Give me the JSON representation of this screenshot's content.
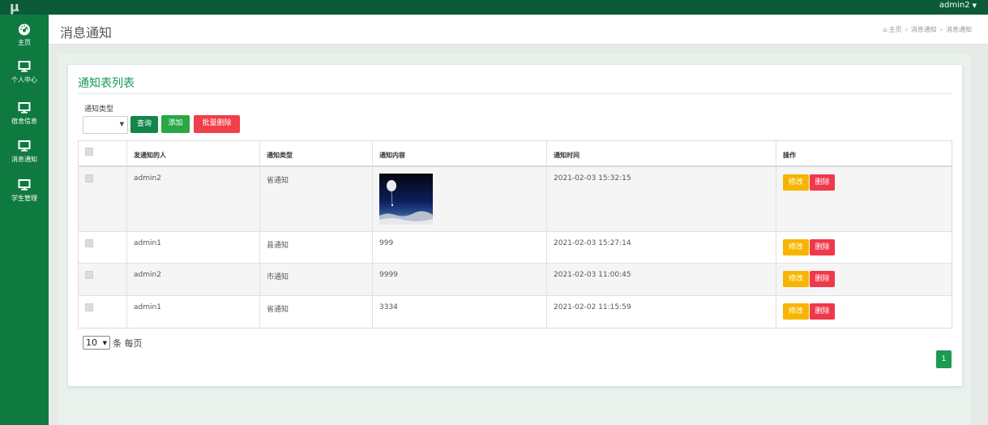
{
  "app": {
    "logo_text": "μ",
    "user": "admin2"
  },
  "sidebar": {
    "items": [
      {
        "label": "主页",
        "icon": "dashboard-icon"
      },
      {
        "label": "个人中心",
        "icon": "monitor-icon"
      },
      {
        "label": "宿舍信息",
        "icon": "monitor-icon"
      },
      {
        "label": "消息通知",
        "icon": "monitor-icon"
      },
      {
        "label": "学生管理",
        "icon": "monitor-icon"
      }
    ]
  },
  "header": {
    "title": "消息通知",
    "breadcrumb": [
      "主页",
      "消息通知",
      "消息通知"
    ],
    "breadcrumb_sep": "›"
  },
  "panel": {
    "title": "通知表列表",
    "filter_label": "通知类型",
    "filter_value": "",
    "buttons": {
      "query": "查询",
      "add": "添加",
      "batch_delete": "批量删除"
    }
  },
  "table": {
    "headers": [
      "发通知的人",
      "通知类型",
      "通知内容",
      "通知时间",
      "操作"
    ],
    "rows": [
      {
        "sender": "admin2",
        "type": "省通知",
        "content": "",
        "content_image": "balloon-sky-image",
        "time": "2021-02-03 15:32:15"
      },
      {
        "sender": "admin1",
        "type": "县通知",
        "content": "999",
        "time": "2021-02-03 15:27:14"
      },
      {
        "sender": "admin2",
        "type": "市通知",
        "content": "9999",
        "time": "2021-02-03 11:00:45"
      },
      {
        "sender": "admin1",
        "type": "省通知",
        "content": "3334",
        "time": "2021-02-02 11:15:59"
      }
    ],
    "edit_label": "修改",
    "delete_label": "删除"
  },
  "pagination": {
    "page_size": "10",
    "page_size_suffix": "条 每页",
    "current_page": "1"
  },
  "colors": {
    "topbar": "#0c5a37",
    "sidebar": "#0f7a40",
    "accent": "#169a52",
    "warning": "#f7b500",
    "danger": "#f0384b"
  }
}
